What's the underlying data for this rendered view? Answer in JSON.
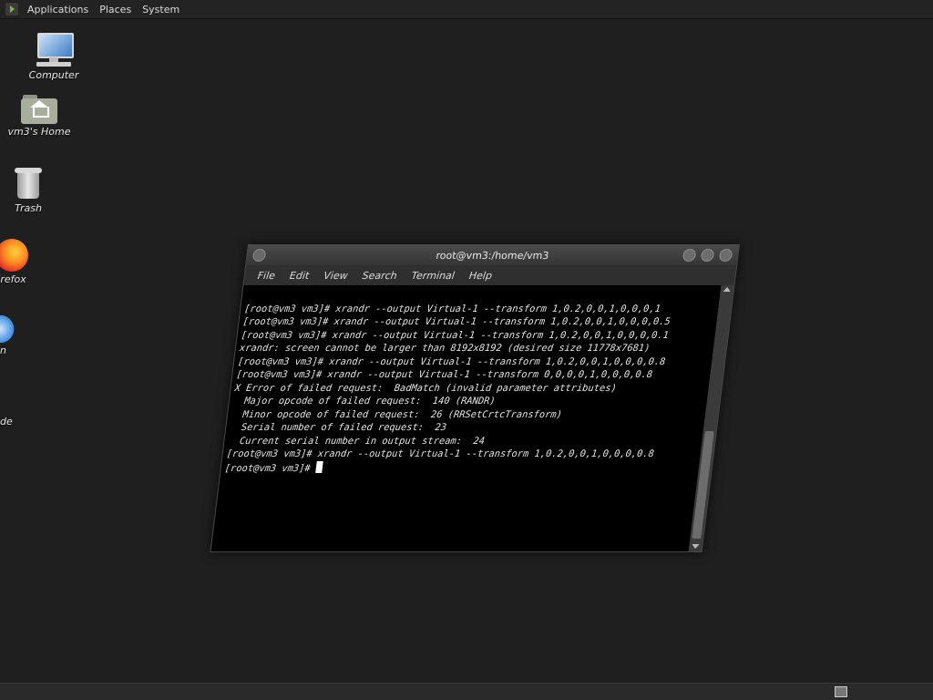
{
  "top_panel": {
    "menus": [
      "Applications",
      "Places",
      "System"
    ]
  },
  "desktop_icons": [
    {
      "label": "Computer",
      "icon": "computer-icon"
    },
    {
      "label": "vm3's Home",
      "icon": "home-folder-icon"
    },
    {
      "label": "Trash",
      "icon": "trash-icon"
    },
    {
      "label": "irefox",
      "icon": "firefox-icon"
    },
    {
      "label": "n",
      "icon": "app-icon"
    },
    {
      "label": "de",
      "icon": "app-icon"
    }
  ],
  "terminal": {
    "title": "root@vm3:/home/vm3",
    "menu": [
      "File",
      "Edit",
      "View",
      "Search",
      "Terminal",
      "Help"
    ],
    "lines": [
      "[root@vm3 vm3]# xrandr --output Virtual-1 --transform 1,0.2,0,0,1,0,0,0,1",
      "[root@vm3 vm3]# xrandr --output Virtual-1 --transform 1,0.2,0,0,1,0,0,0,0.5",
      "[root@vm3 vm3]# xrandr --output Virtual-1 --transform 1,0.2,0,0,1,0,0,0,0.1",
      "xrandr: screen cannot be larger than 8192x8192 (desired size 11778x7681)",
      "[root@vm3 vm3]# xrandr --output Virtual-1 --transform 1,0.2,0,0,1,0,0,0,0.8",
      "[root@vm3 vm3]# xrandr --output Virtual-1 --transform 0,0,0,0,1,0,0,0,0.8",
      "X Error of failed request:  BadMatch (invalid parameter attributes)",
      "  Major opcode of failed request:  140 (RANDR)",
      "  Minor opcode of failed request:  26 (RRSetCrtcTransform)",
      "  Serial number of failed request:  23",
      "  Current serial number in output stream:  24",
      "[root@vm3 vm3]# xrandr --output Virtual-1 --transform 1,0.2,0,0,1,0,0,0,0.8"
    ],
    "prompt": "[root@vm3 vm3]# "
  }
}
